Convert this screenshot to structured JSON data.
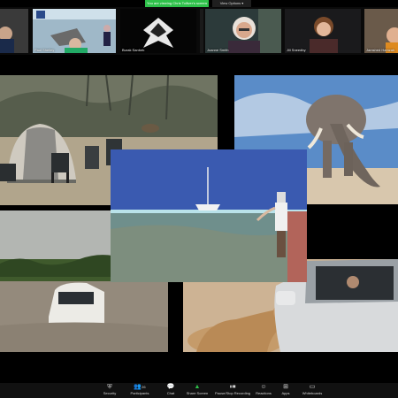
{
  "banner": {
    "text": "You are viewing Chris Tolliver's screen"
  },
  "view_options": {
    "label": "View Options ▾"
  },
  "participants": [
    {
      "name": ""
    },
    {
      "name": "Paul Shelley"
    },
    {
      "name": "Burak Sarıbek"
    },
    {
      "name": ""
    },
    {
      "name": "Joanne Smith"
    },
    {
      "name": "Jill Sneedby"
    },
    {
      "name": "Jamshed Hamzah"
    }
  ],
  "toolbar": {
    "items": [
      {
        "label": "Security",
        "icon": "shield-icon"
      },
      {
        "label": "Participants",
        "count": "26",
        "icon": "people-icon"
      },
      {
        "label": "Chat",
        "icon": "chat-icon"
      },
      {
        "label": "Share Screen",
        "icon": "share-screen-icon"
      },
      {
        "label": "Pause/Stop Recording",
        "icon": "record-icon"
      },
      {
        "label": "Reactions",
        "icon": "emoji-icon"
      },
      {
        "label": "Apps",
        "icon": "apps-icon"
      },
      {
        "label": "Whiteboards",
        "icon": "whiteboard-icon"
      }
    ]
  },
  "colors": {
    "share_green": "#2ec14a",
    "toolbar_bg": "#111111"
  }
}
